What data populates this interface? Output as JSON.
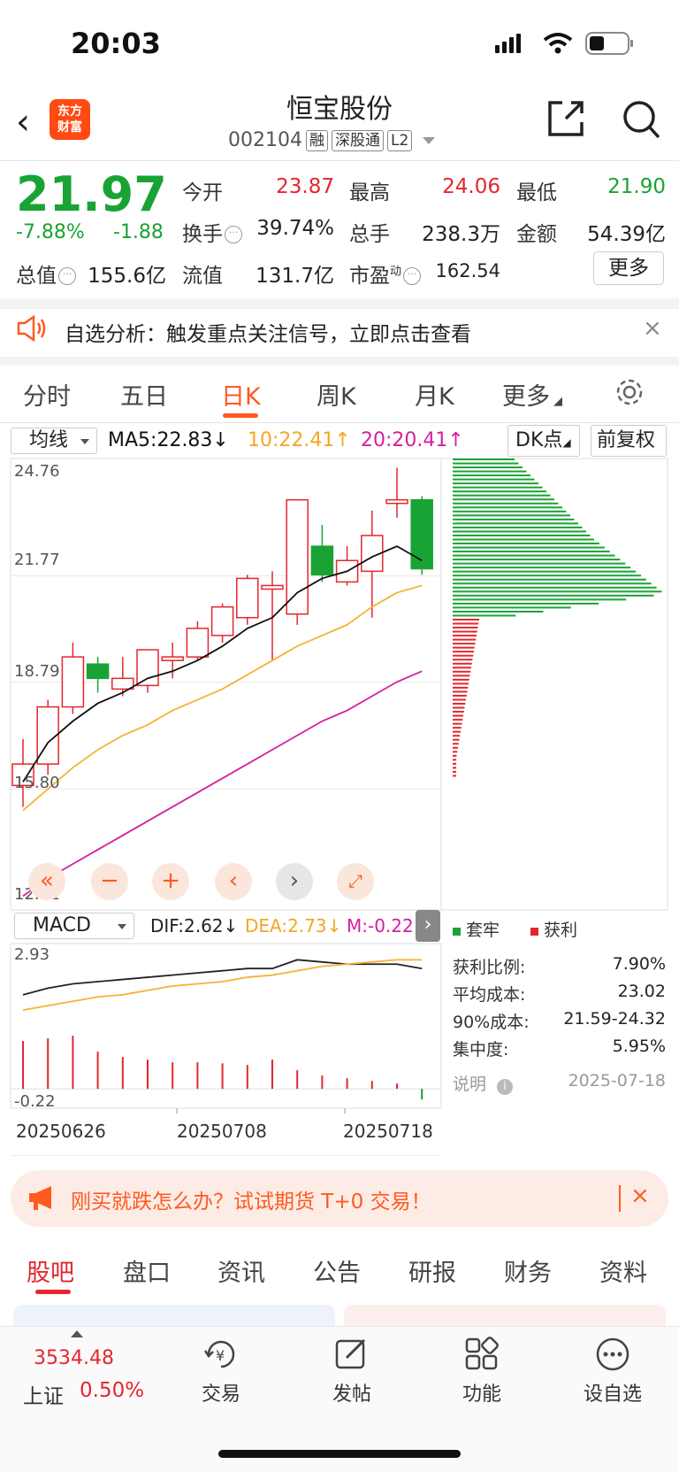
{
  "status": {
    "time": "20:03"
  },
  "header": {
    "back": "‹",
    "logo_line1": "东方",
    "logo_line2": "财富",
    "name": "恒宝股份",
    "code": "002104",
    "tags": [
      "融",
      "深股通",
      "L2"
    ]
  },
  "quote": {
    "price": "21.97",
    "change_pct": "-7.88%",
    "change_amt": "-1.88",
    "open_label": "今开",
    "open": "23.87",
    "high_label": "最高",
    "high": "24.06",
    "low_label": "最低",
    "low": "21.90",
    "turnover_label": "换手",
    "turnover": "39.74%",
    "volume_label": "总手",
    "volume": "238.3万",
    "amount_label": "金额",
    "amount": "54.39亿",
    "mcap_label": "总值",
    "mcap": "155.6亿",
    "float_label": "流值",
    "float": "131.7亿",
    "pe_label": "市盈",
    "pe_sup": "动",
    "pe": "162.54",
    "more": "更多"
  },
  "banner": {
    "text": "自选分析：触发重点关注信号，立即点击查看",
    "close": "×"
  },
  "period_tabs": [
    "分时",
    "五日",
    "日K",
    "周K",
    "月K",
    "更多"
  ],
  "period_active": "日K",
  "ma": {
    "select": "均线",
    "ma5": "MA5:22.83",
    "ma10": "10:22.41",
    "ma20": "20:20.41",
    "dk": "DK点",
    "fq": "前复权",
    "arrow_down": "↓",
    "arrow_up": "↑"
  },
  "chart_data": {
    "type": "candlestick",
    "y_ticks": [
      "24.76",
      "21.77",
      "18.79",
      "15.80",
      "12.81"
    ],
    "ylim": [
      12.81,
      24.76
    ],
    "candles": [
      {
        "o": 15.9,
        "h": 17.2,
        "l": 15.3,
        "c": 16.5
      },
      {
        "o": 16.5,
        "h": 18.3,
        "l": 16.2,
        "c": 18.1
      },
      {
        "o": 18.1,
        "h": 19.9,
        "l": 17.9,
        "c": 19.5
      },
      {
        "o": 19.3,
        "h": 19.5,
        "l": 18.5,
        "c": 18.9
      },
      {
        "o": 18.6,
        "h": 19.5,
        "l": 18.4,
        "c": 18.9
      },
      {
        "o": 18.7,
        "h": 19.7,
        "l": 18.5,
        "c": 19.7
      },
      {
        "o": 19.4,
        "h": 19.9,
        "l": 18.9,
        "c": 19.5
      },
      {
        "o": 19.5,
        "h": 20.5,
        "l": 19.4,
        "c": 20.3
      },
      {
        "o": 20.1,
        "h": 21.0,
        "l": 19.9,
        "c": 20.9
      },
      {
        "o": 20.6,
        "h": 21.8,
        "l": 20.4,
        "c": 21.7
      },
      {
        "o": 21.4,
        "h": 21.9,
        "l": 19.4,
        "c": 21.5
      },
      {
        "o": 20.7,
        "h": 23.9,
        "l": 20.4,
        "c": 23.9
      },
      {
        "o": 22.6,
        "h": 23.2,
        "l": 21.6,
        "c": 21.8
      },
      {
        "o": 21.6,
        "h": 22.6,
        "l": 21.5,
        "c": 22.2
      },
      {
        "o": 21.9,
        "h": 23.6,
        "l": 20.6,
        "c": 22.9
      },
      {
        "o": 23.8,
        "h": 24.8,
        "l": 23.4,
        "c": 23.9
      },
      {
        "o": 23.9,
        "h": 24.0,
        "l": 21.8,
        "c": 21.97
      }
    ],
    "ma5": [
      16.0,
      17.1,
      17.7,
      18.2,
      18.5,
      18.9,
      19.1,
      19.4,
      19.8,
      20.3,
      20.6,
      21.3,
      21.7,
      21.9,
      22.3,
      22.6,
      22.2
    ],
    "ma10": [
      15.2,
      15.8,
      16.4,
      16.9,
      17.3,
      17.6,
      18.0,
      18.3,
      18.6,
      19.0,
      19.4,
      19.8,
      20.1,
      20.4,
      20.9,
      21.3,
      21.5
    ],
    "ma20": [
      12.8,
      13.3,
      13.7,
      14.1,
      14.5,
      14.9,
      15.3,
      15.7,
      16.1,
      16.5,
      16.9,
      17.3,
      17.7,
      18.0,
      18.4,
      18.8,
      19.1
    ],
    "chip_bars": 80,
    "macd_select": "MACD",
    "dif_label": "DIF:2.62",
    "dea_label": "DEA:2.73",
    "m_label": "M:-0.22",
    "macd_ticks": [
      "2.93",
      "-0.22"
    ],
    "macd_hist": [
      0.9,
      0.95,
      1.0,
      0.7,
      0.6,
      0.55,
      0.5,
      0.5,
      0.48,
      0.45,
      0.55,
      0.35,
      0.25,
      0.2,
      0.15,
      0.1,
      -0.2
    ],
    "dif": [
      1.0,
      1.3,
      1.5,
      1.6,
      1.7,
      1.8,
      1.9,
      2.0,
      2.1,
      2.2,
      2.2,
      2.6,
      2.5,
      2.4,
      2.4,
      2.4,
      2.2
    ],
    "dea": [
      0.3,
      0.5,
      0.7,
      0.9,
      1.0,
      1.2,
      1.4,
      1.5,
      1.6,
      1.8,
      1.9,
      2.1,
      2.3,
      2.4,
      2.5,
      2.6,
      2.6
    ],
    "x_labels": [
      "20250626",
      "20250708",
      "20250718"
    ]
  },
  "chip": {
    "legend_trapped": "套牢",
    "legend_profit": "获利",
    "rows": [
      {
        "label": "获利比例:",
        "value": "7.90%"
      },
      {
        "label": "平均成本:",
        "value": "23.02"
      },
      {
        "label": "90%成本:",
        "value": "21.59-24.32"
      },
      {
        "label": "集中度:",
        "value": "5.95%"
      }
    ],
    "note_label": "说明",
    "date": "2025-07-18",
    "colors": {
      "green": "#1aa335",
      "red": "#e5262d"
    }
  },
  "promo": {
    "text": "刚买就跌怎么办？试试期货 T+0 交易！",
    "close": "×"
  },
  "bottom_tabs": [
    "股吧",
    "盘口",
    "资讯",
    "公告",
    "研报",
    "财务",
    "资料"
  ],
  "bottom_tab_active": "股吧",
  "nav": {
    "index_value": "3534.48",
    "index_name": "上证",
    "index_pct": "0.50%",
    "items": [
      "交易",
      "发帖",
      "功能",
      "设自选"
    ]
  }
}
